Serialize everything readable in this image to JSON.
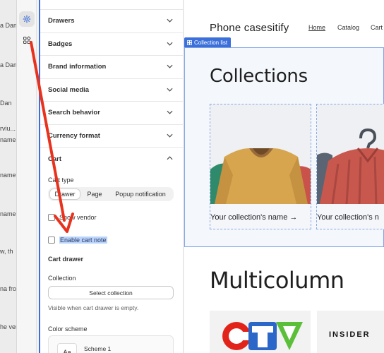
{
  "left_strip": {
    "fragments": [
      "a Dan",
      "a Dan",
      "Dan",
      "rviu...",
      "name",
      "name",
      "name",
      "w, th",
      "na fro",
      "he ver"
    ]
  },
  "rail": {
    "items": [
      {
        "name": "theme-settings",
        "icon": "gear-icon",
        "active": true
      },
      {
        "name": "apps",
        "icon": "apps-icon",
        "active": false
      }
    ]
  },
  "settings": {
    "sections": [
      "Drawers",
      "Badges",
      "Brand information",
      "Social media",
      "Search behavior",
      "Currency format"
    ],
    "cart_section": "Cart",
    "cart_type_label": "Cart type",
    "cart_type_options": [
      "Drawer",
      "Page",
      "Popup notification"
    ],
    "cart_type_selected": "Drawer",
    "show_vendor_label": "Show vendor",
    "show_vendor_checked": false,
    "enable_cart_note_label": "Enable cart note",
    "enable_cart_note_checked": false,
    "cart_drawer_title": "Cart drawer",
    "collection_label": "Collection",
    "select_collection_button": "Select collection",
    "collection_help": "Visible when cart drawer is empty.",
    "color_scheme_label": "Color scheme",
    "color_scheme_swatch": "Aa",
    "color_scheme_value": "Scheme 1"
  },
  "preview": {
    "store_name": "Phone casesitify",
    "nav": [
      "Home",
      "Catalog",
      "Cart"
    ],
    "selection_tag": "Collection list",
    "collections_heading": "Collections",
    "collection_cards": [
      {
        "title": "Your collection's name →"
      },
      {
        "title": "Your collection's n"
      }
    ],
    "multicolumn_heading": "Multicolumn",
    "logos": [
      "CTV",
      "INSIDER"
    ]
  },
  "colors": {
    "accent": "#3b6fd9",
    "annotation_arrow": "#e8321e",
    "selection": "#b9d3fb"
  }
}
